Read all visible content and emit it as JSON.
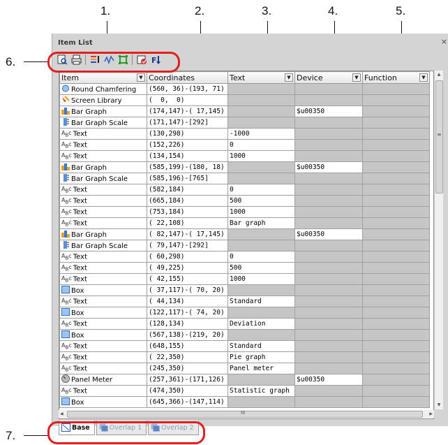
{
  "callouts": {
    "c1": "1.",
    "c2": "2.",
    "c3": "3.",
    "c4": "4.",
    "c5": "5.",
    "c6": "6.",
    "c7": "7."
  },
  "window": {
    "title": "Item List",
    "close": "×"
  },
  "toolbar": {
    "icons": [
      "print-preview-icon",
      "print-icon",
      "list-filter-icon",
      "waveform-icon",
      "box-select-icon",
      "settings-icon",
      "sort-icon"
    ]
  },
  "columns": [
    "Item",
    "Coordinates",
    "Text",
    "Device",
    "Function"
  ],
  "rows": [
    {
      "icon": "round-chamfer-icon",
      "item": "Round Chamfering",
      "coords": "(560, 36)-(193, 71)",
      "text": null,
      "device": null
    },
    {
      "icon": "screen-library-icon",
      "item": "Screen Library",
      "coords": "(  0,  0)",
      "text": null,
      "device": null
    },
    {
      "icon": "bar-graph-icon",
      "item": "Bar Graph",
      "coords": "(174,147)-( 17,145)",
      "text": null,
      "device": "$u00350"
    },
    {
      "icon": "bar-graph-scale-icon",
      "item": "Bar Graph Scale",
      "coords": "(171,147)-[292]",
      "text": null,
      "device": null
    },
    {
      "icon": "text-icon",
      "item": "Text",
      "coords": "(130,298)",
      "text": "-1000",
      "device": null
    },
    {
      "icon": "text-icon",
      "item": "Text",
      "coords": "(152,226)",
      "text": "0",
      "device": null
    },
    {
      "icon": "text-icon",
      "item": "Text",
      "coords": "(134,154)",
      "text": "1000",
      "device": null
    },
    {
      "icon": "bar-graph-icon",
      "item": "Bar Graph",
      "coords": "(585,199)-(180, 18)",
      "text": null,
      "device": "$u00350"
    },
    {
      "icon": "bar-graph-scale-icon",
      "item": "Bar Graph Scale",
      "coords": "(585,196)-[765]",
      "text": null,
      "device": null
    },
    {
      "icon": "text-icon",
      "item": "Text",
      "coords": "(582,184)",
      "text": "0",
      "device": null
    },
    {
      "icon": "text-icon",
      "item": "Text",
      "coords": "(665,184)",
      "text": "500",
      "device": null
    },
    {
      "icon": "text-icon",
      "item": "Text",
      "coords": "(753,184)",
      "text": "1000",
      "device": null
    },
    {
      "icon": "text-icon",
      "item": "Text",
      "coords": "( 22,108)",
      "text": "Bar graph",
      "device": null
    },
    {
      "icon": "bar-graph-icon",
      "item": "Bar Graph",
      "coords": "( 82,147)-( 17,145)",
      "text": null,
      "device": "$u00350"
    },
    {
      "icon": "bar-graph-scale-icon",
      "item": "Bar Graph Scale",
      "coords": "( 79,147)-[292]",
      "text": null,
      "device": null
    },
    {
      "icon": "text-icon",
      "item": "Text",
      "coords": "( 60,298)",
      "text": "0",
      "device": null
    },
    {
      "icon": "text-icon",
      "item": "Text",
      "coords": "( 49,225)",
      "text": "500",
      "device": null
    },
    {
      "icon": "text-icon",
      "item": "Text",
      "coords": "( 42,155)",
      "text": "1000",
      "device": null
    },
    {
      "icon": "box-icon",
      "item": "Box",
      "coords": "( 37,117)-( 70, 20)",
      "text": null,
      "device": null
    },
    {
      "icon": "text-icon",
      "item": "Text",
      "coords": "( 44,134)",
      "text": "Standard",
      "device": null
    },
    {
      "icon": "box-icon",
      "item": "Box",
      "coords": "(122,117)-( 74, 20)",
      "text": null,
      "device": null
    },
    {
      "icon": "text-icon",
      "item": "Text",
      "coords": "(128,134)",
      "text": "Deviation",
      "device": null
    },
    {
      "icon": "box-icon",
      "item": "Box",
      "coords": "(567,138)-(219, 20)",
      "text": null,
      "device": null
    },
    {
      "icon": "text-icon",
      "item": "Text",
      "coords": "(648,155)",
      "text": "Standard",
      "device": null
    },
    {
      "icon": "text-icon",
      "item": "Text",
      "coords": "( 22,350)",
      "text": "Pie graph",
      "device": null
    },
    {
      "icon": "text-icon",
      "item": "Text",
      "coords": "(245,350)",
      "text": "Panel meter",
      "device": null
    },
    {
      "icon": "panel-meter-icon",
      "item": "Panel Meter",
      "coords": "(257,361)-(171,126)",
      "text": null,
      "device": "$u00350"
    },
    {
      "icon": "text-icon",
      "item": "Text",
      "coords": "(474,350)",
      "text": "Statistic graph",
      "device": null
    },
    {
      "icon": "box-icon",
      "item": "Box",
      "coords": "(645,366)-(147,114)",
      "text": null,
      "device": null
    }
  ],
  "tabs": [
    {
      "label": "Base",
      "active": true
    },
    {
      "label": "Overlap 1",
      "active": false
    },
    {
      "label": "Overlap 2",
      "active": false
    }
  ],
  "scroll": {
    "up": "▲",
    "down": "▼",
    "left": "◀",
    "right": "▶",
    "h_grip": "III",
    "v_grip": "≡"
  },
  "annotation_color": "#e02020"
}
